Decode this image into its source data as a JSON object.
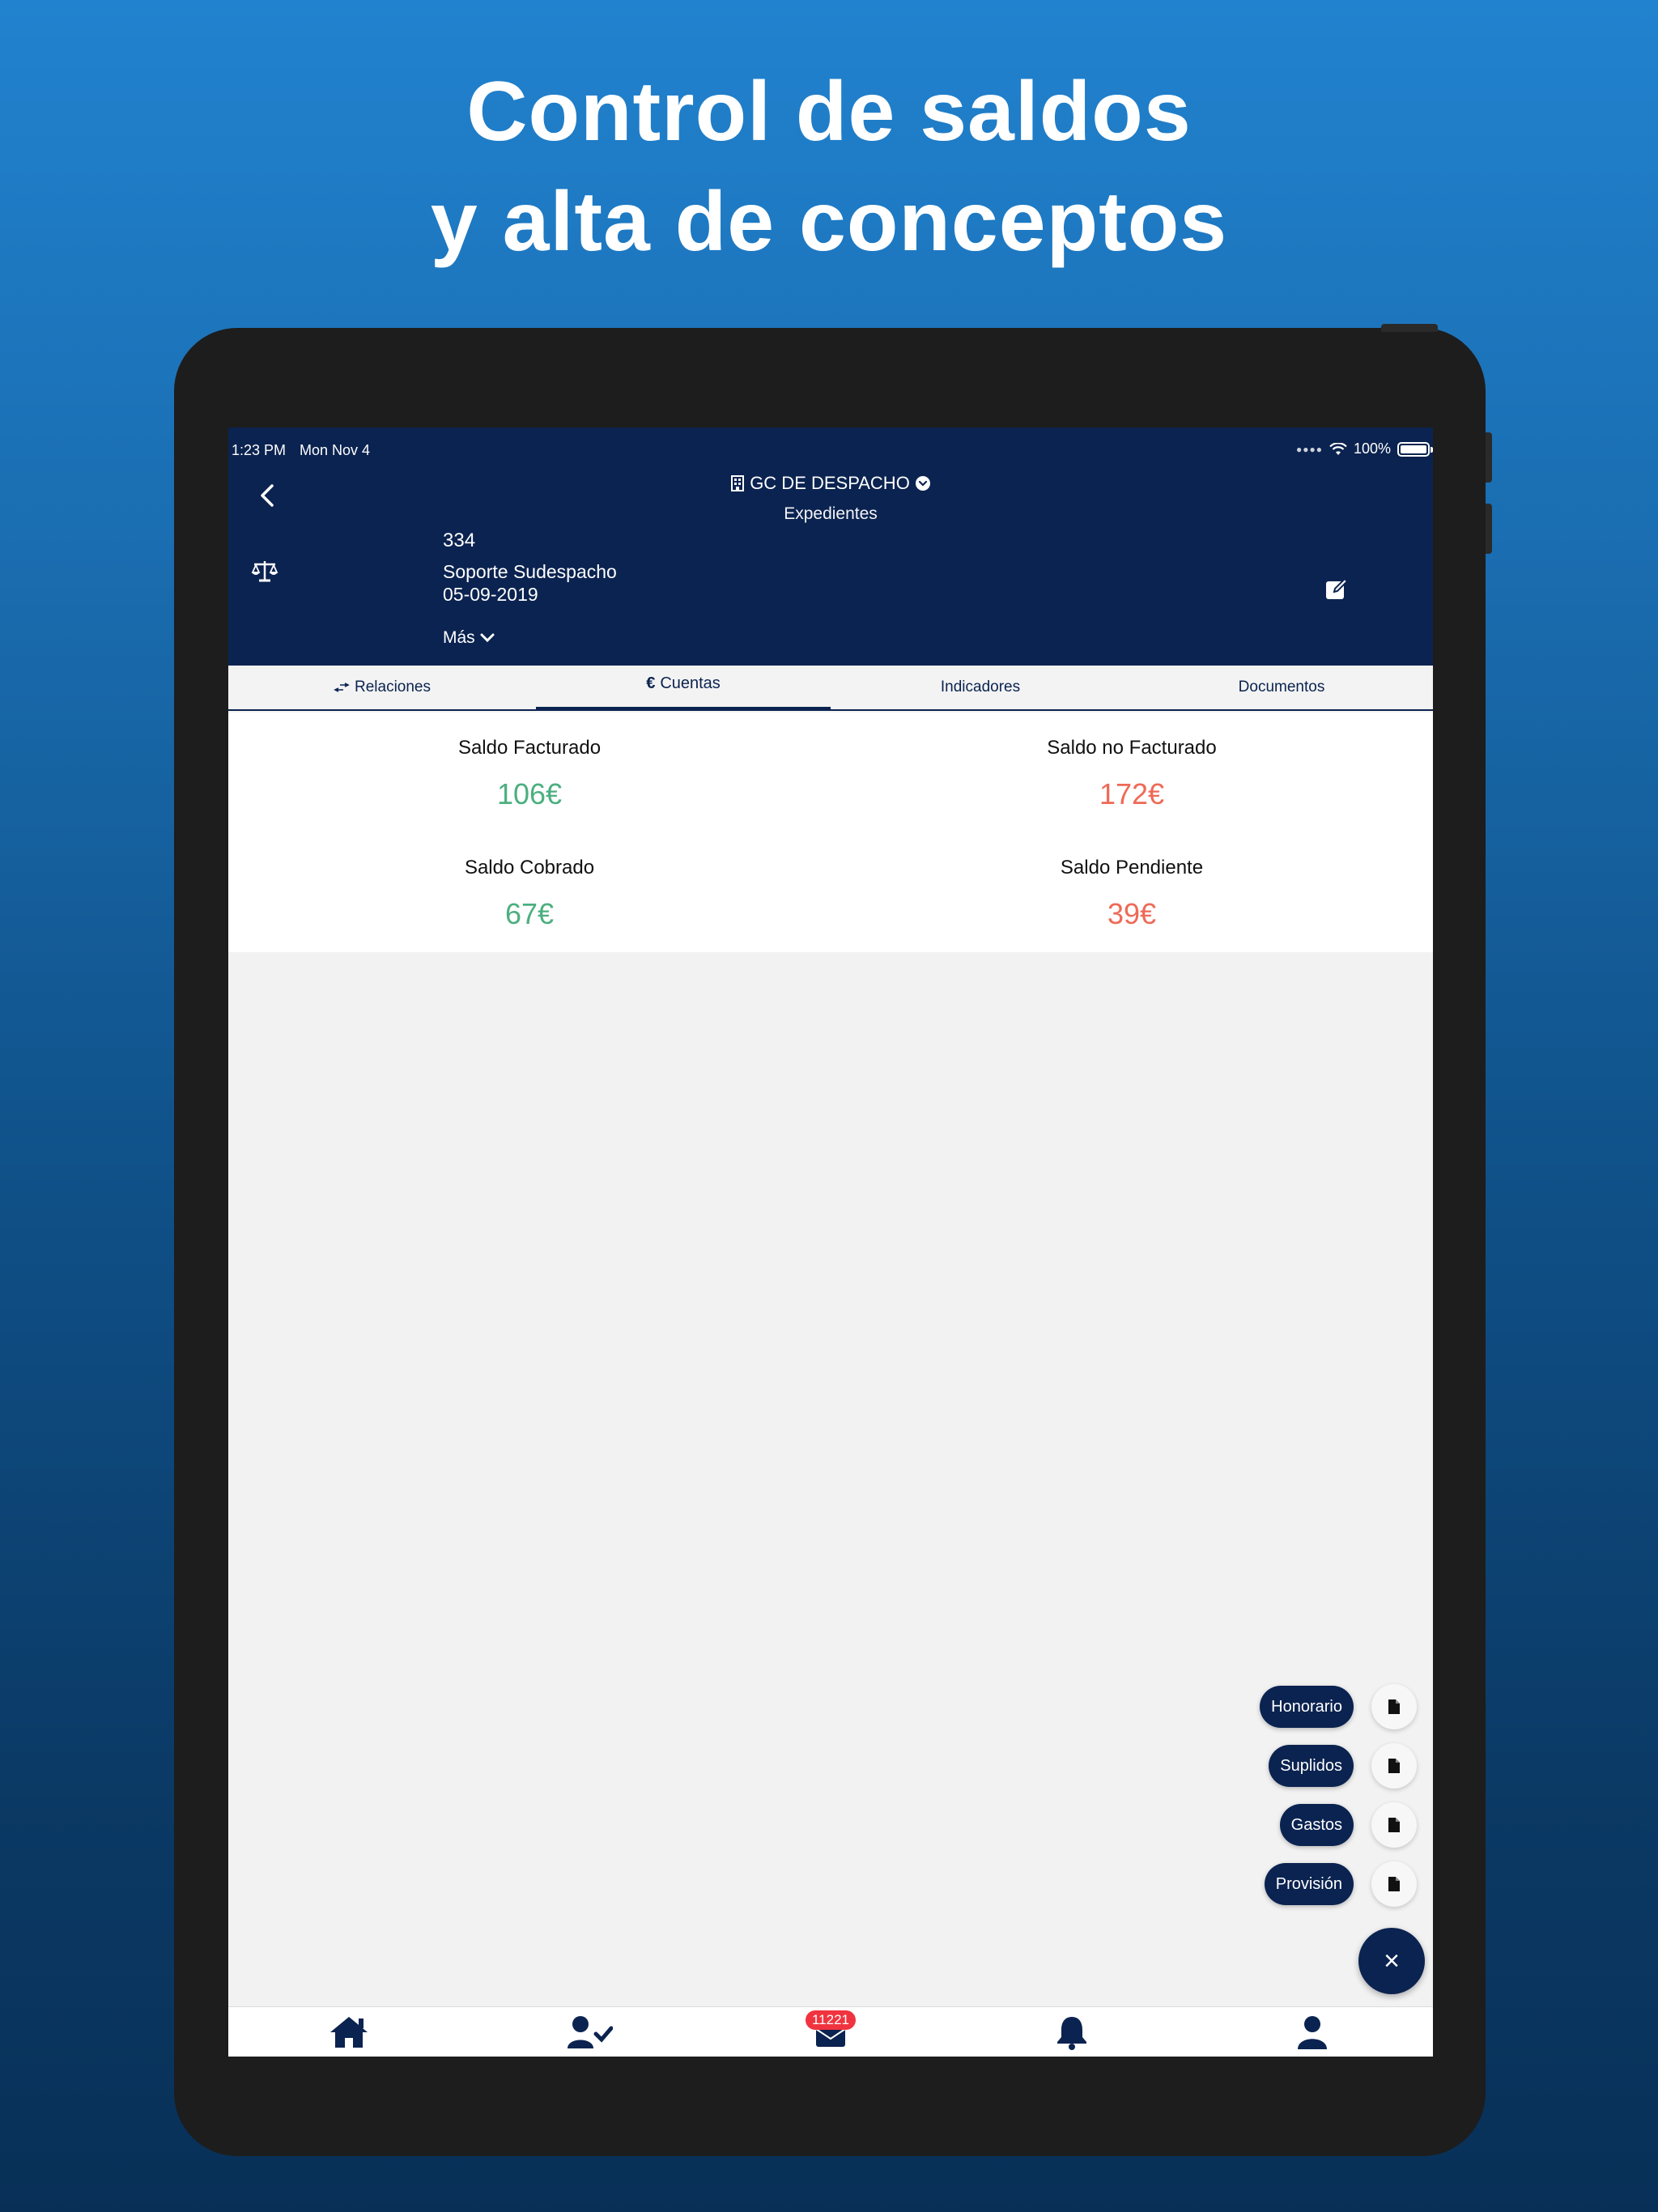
{
  "headline": {
    "line1": "Control de saldos",
    "line2": "y alta de conceptos"
  },
  "status": {
    "time": "1:23 PM",
    "date": "Mon Nov 4",
    "battery": "100%"
  },
  "header": {
    "title": "GC DE DESPACHO",
    "subtitle": "Expedientes",
    "number": "334",
    "client": "Soporte Sudespacho",
    "date": "05-09-2019",
    "more": "Más"
  },
  "tabs": [
    {
      "label": "Relaciones",
      "icon": "arrows-swap-icon"
    },
    {
      "label": "Cuentas",
      "icon": "euro-icon"
    },
    {
      "label": "Indicadores"
    },
    {
      "label": "Documentos"
    }
  ],
  "balances": {
    "facturado": {
      "label": "Saldo Facturado",
      "value": "106€"
    },
    "no_facturado": {
      "label": "Saldo no Facturado",
      "value": "172€"
    },
    "cobrado": {
      "label": "Saldo Cobrado",
      "value": "67€"
    },
    "pendiente": {
      "label": "Saldo Pendiente",
      "value": "39€"
    }
  },
  "fab_actions": [
    "Honorario",
    "Suplidos",
    "Gastos",
    "Provisión"
  ],
  "fab_close": "×",
  "nav": {
    "badge": "11221"
  },
  "colors": {
    "navy": "#0b2350",
    "positive": "#4caf7f",
    "negative": "#ee6a57",
    "badge": "#f0343f"
  }
}
